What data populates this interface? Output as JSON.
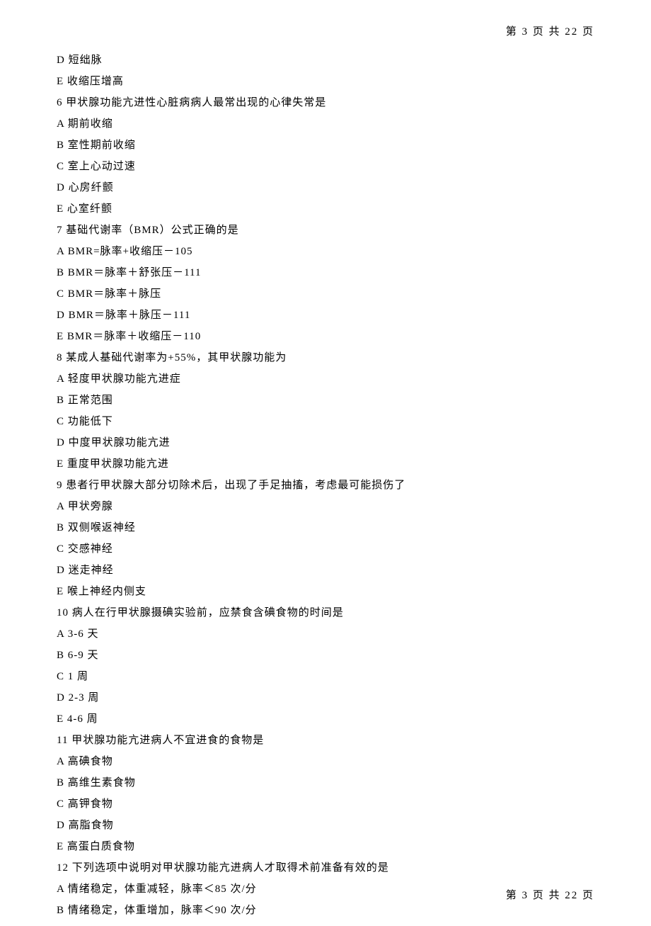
{
  "header": "第 3 页 共 22 页",
  "footer": "第 3 页 共 22 页",
  "lines": [
    "D 短绌脉",
    "E 收缩压增高",
    "6 甲状腺功能亢进性心脏病病人最常出现的心律失常是",
    "A 期前收缩",
    "B 室性期前收缩",
    "C 室上心动过速",
    "D 心房纤颤",
    "E 心室纤颤",
    "7 基础代谢率（BMR）公式正确的是",
    "A BMR=脉率+收缩压－105",
    "B BMR＝脉率＋舒张压－111",
    "C BMR＝脉率＋脉压",
    "D BMR＝脉率＋脉压－111",
    "E BMR＝脉率＋收缩压－110",
    "8 某成人基础代谢率为+55%，其甲状腺功能为",
    "A 轻度甲状腺功能亢进症",
    "B 正常范围",
    "C 功能低下",
    "D 中度甲状腺功能亢进",
    "E 重度甲状腺功能亢进",
    "9 患者行甲状腺大部分切除术后，出现了手足抽搐，考虑最可能损伤了",
    "A 甲状旁腺",
    "B 双侧喉返神经",
    "C 交感神经",
    "D 迷走神经",
    "E 喉上神经内侧支",
    "10 病人在行甲状腺摄碘实验前，应禁食含碘食物的时间是",
    "A 3-6 天",
    "B 6-9 天",
    "C 1 周",
    "D 2-3 周",
    "E 4-6 周",
    "11 甲状腺功能亢进病人不宜进食的食物是",
    "A 高碘食物",
    "B 高维生素食物",
    "C 高钾食物",
    "D 高脂食物",
    "E 高蛋白质食物",
    "12 下列选项中说明对甲状腺功能亢进病人才取得术前准备有效的是",
    "A 情绪稳定，体重减轻，脉率＜85 次/分",
    "B 情绪稳定，体重增加，脉率＜90 次/分"
  ]
}
